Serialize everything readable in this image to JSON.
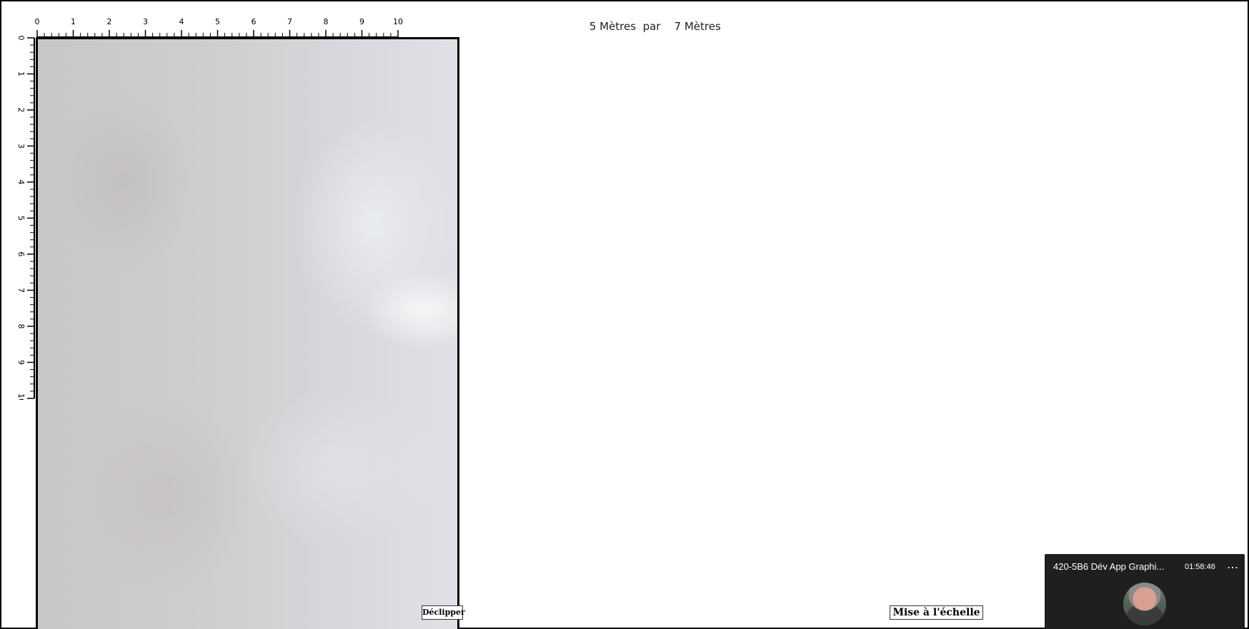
{
  "dimensions": {
    "width_value": "5",
    "width_unit": "Mètres",
    "separator": "par",
    "height_value": "7",
    "height_unit": "Mètres"
  },
  "rulers": {
    "horizontal_labels": [
      "0",
      "1",
      "2",
      "3",
      "4",
      "5",
      "6",
      "7",
      "8",
      "9",
      "10"
    ],
    "vertical_labels": [
      "0",
      "1",
      "2",
      "3",
      "4",
      "5",
      "6",
      "7",
      "8",
      "9",
      "10"
    ]
  },
  "canvas": {
    "image_name": "textured-wall-image"
  },
  "buttons": {
    "declip_label": "Déclipper",
    "scale_label": "Mise à l'échelle"
  },
  "meeting_widget": {
    "title": "420-5B6 Dév App Graphi...",
    "time": "01:58:46",
    "more_icon": "more-icon",
    "more_glyph": "…"
  }
}
